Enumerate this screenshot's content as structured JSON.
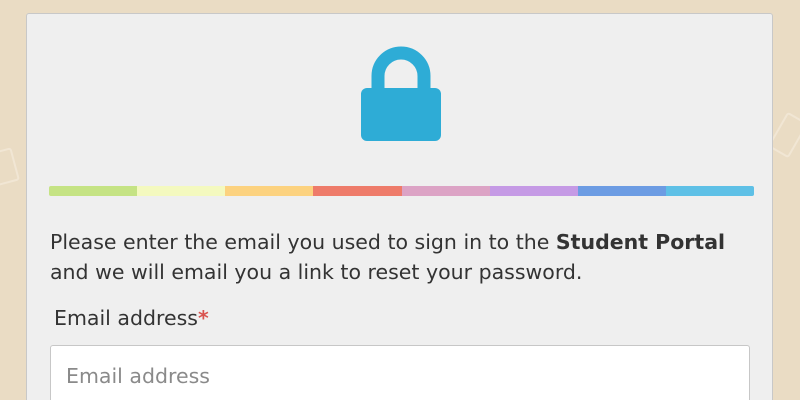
{
  "lock_icon": {
    "name": "lock-icon",
    "color": "#2eacd6"
  },
  "rainbow_colors": [
    "#c5e384",
    "#f4f9bf",
    "#fcd27f",
    "#ee7b6a",
    "#dca3c5",
    "#c59ae5",
    "#6c9ce3",
    "#5ec0e6"
  ],
  "reset": {
    "message_part1": "Please enter the email you used to sign in to the ",
    "portal_name": "Student Portal",
    "message_part2": "and we will email you a link to reset your password."
  },
  "email_field": {
    "label": "Email address",
    "required_marker": "*",
    "placeholder": "Email address",
    "value": ""
  },
  "colors": {
    "background": "#eadcc4",
    "card": "#efefef",
    "text": "#333333",
    "required": "#d9534f"
  }
}
